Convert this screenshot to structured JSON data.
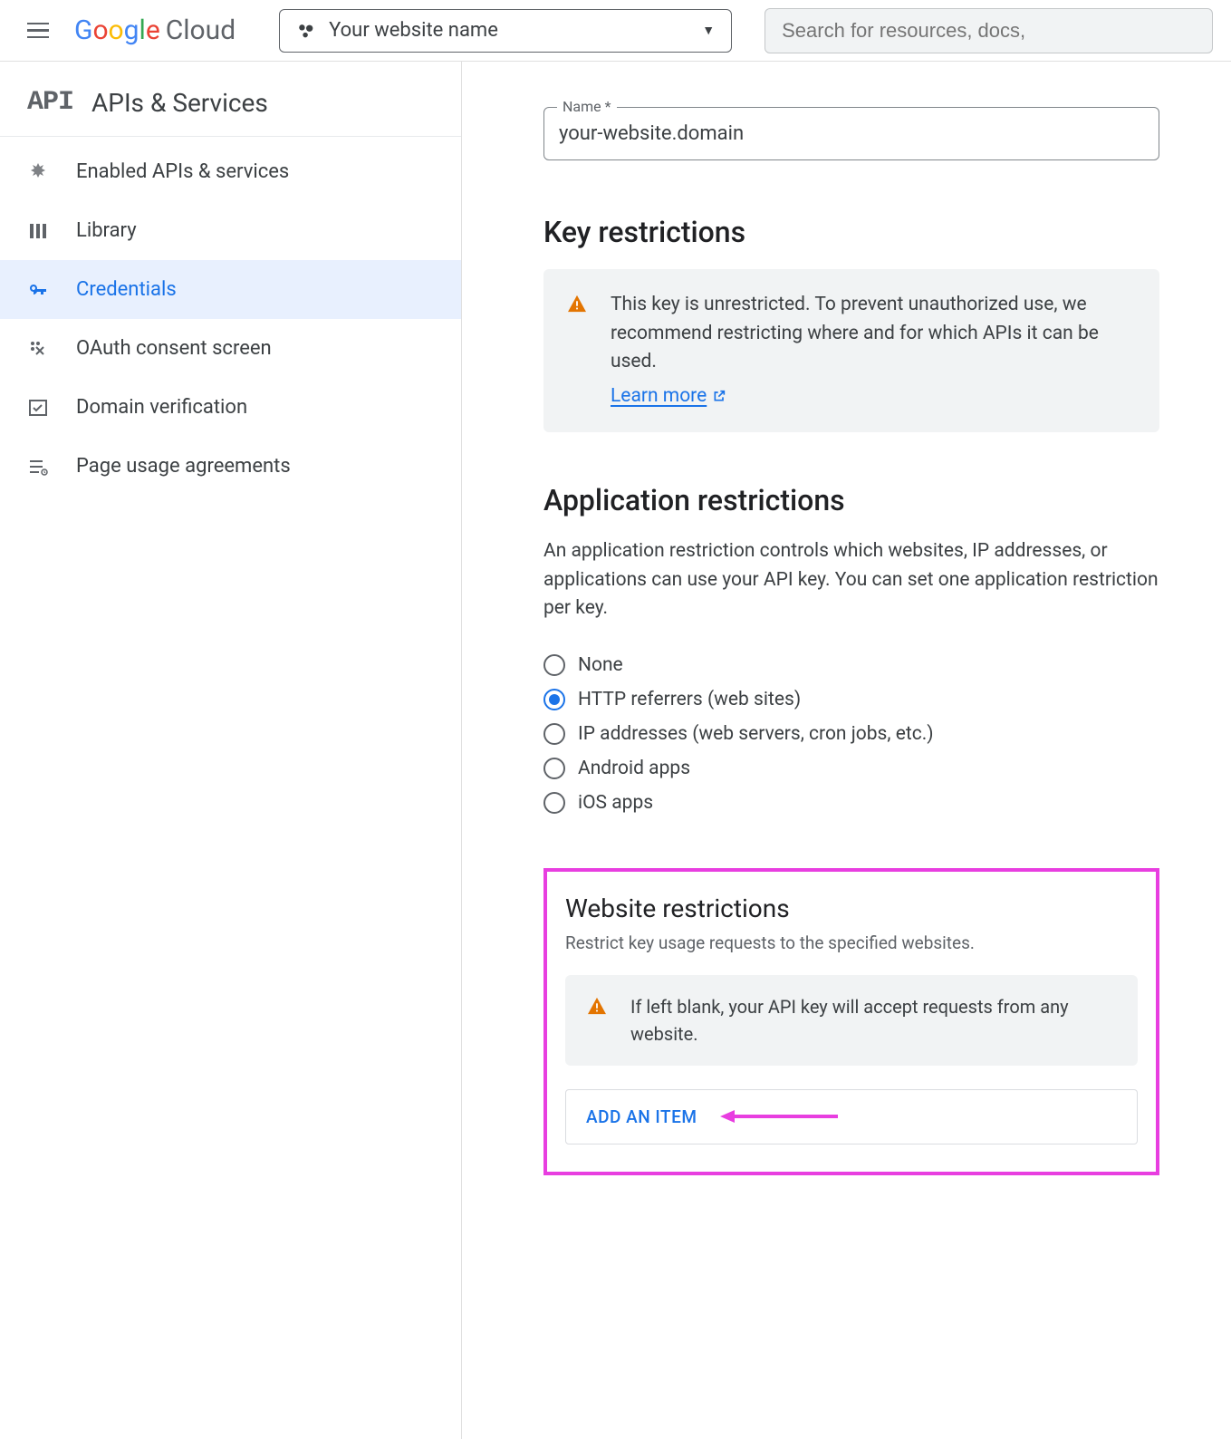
{
  "header": {
    "logo_google": "Google",
    "logo_cloud": "Cloud",
    "project_name": "Your website name",
    "search_placeholder": "Search for resources, docs,"
  },
  "sidebar": {
    "api_label": "API",
    "title": "APIs & Services",
    "items": [
      {
        "label": "Enabled APIs & services"
      },
      {
        "label": "Library"
      },
      {
        "label": "Credentials"
      },
      {
        "label": "OAuth consent screen"
      },
      {
        "label": "Domain verification"
      },
      {
        "label": "Page usage agreements"
      }
    ]
  },
  "content": {
    "name_field_label": "Name *",
    "name_field_value": "your-website.domain",
    "key_restrictions_heading": "Key restrictions",
    "key_restrictions_warning": "This key is unrestricted. To prevent unauthorized use, we recommend restricting where and for which APIs it can be used.",
    "learn_more": "Learn more",
    "app_restrictions_heading": "Application restrictions",
    "app_restrictions_desc": "An application restriction controls which websites, IP addresses, or applications can use your API key. You can set one application restriction per key.",
    "radios": [
      {
        "label": "None"
      },
      {
        "label": "HTTP referrers (web sites)"
      },
      {
        "label": "IP addresses (web servers, cron jobs, etc.)"
      },
      {
        "label": "Android apps"
      },
      {
        "label": "iOS apps"
      }
    ],
    "website_restrictions_heading": "Website restrictions",
    "website_restrictions_desc": "Restrict key usage requests to the specified websites.",
    "website_restrictions_warning": "If left blank, your API key will accept requests from any website.",
    "add_item_label": "ADD AN ITEM"
  }
}
